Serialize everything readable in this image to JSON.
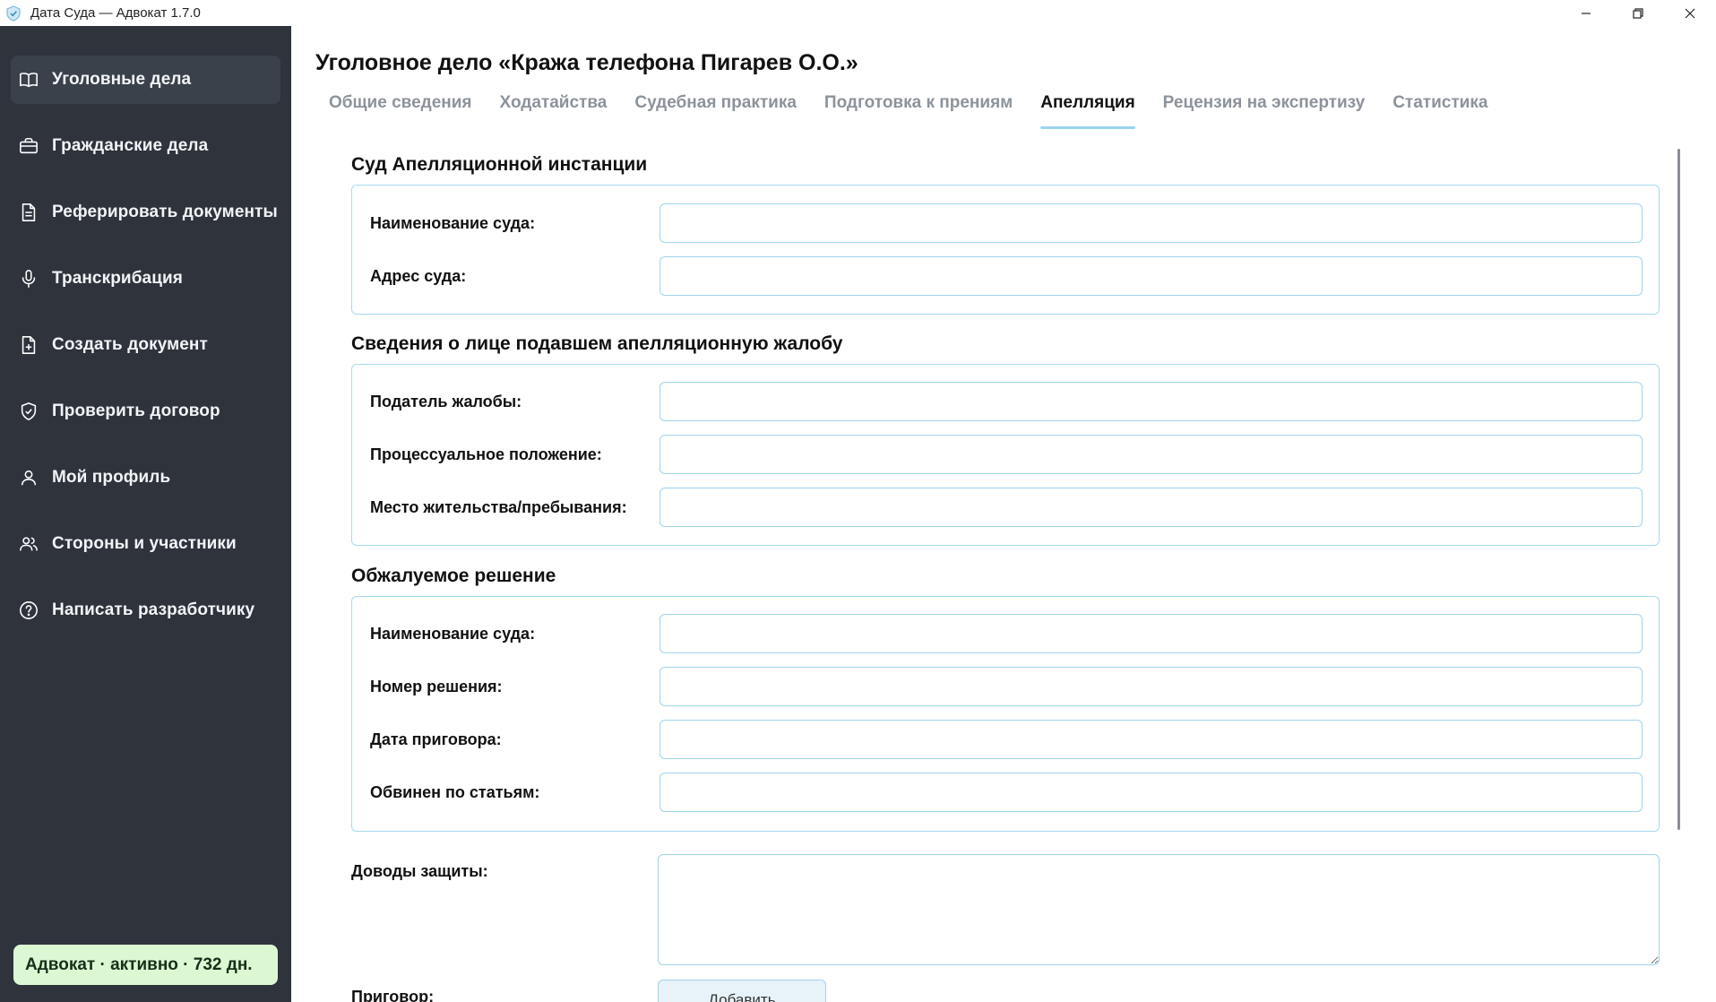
{
  "window": {
    "title": "Дата Суда — Адвокат 1.7.0"
  },
  "sidebar": {
    "items": [
      {
        "label": "Уголовные дела",
        "icon": "book-icon"
      },
      {
        "label": "Гражданские дела",
        "icon": "briefcase-icon"
      },
      {
        "label": "Реферировать документы",
        "icon": "document-text-icon"
      },
      {
        "label": "Транскрибация",
        "icon": "microphone-icon"
      },
      {
        "label": "Создать документ",
        "icon": "document-plus-icon"
      },
      {
        "label": "Проверить договор",
        "icon": "shield-check-icon"
      },
      {
        "label": "Мой профиль",
        "icon": "user-icon"
      },
      {
        "label": "Стороны и участники",
        "icon": "users-icon"
      },
      {
        "label": "Написать разработчику",
        "icon": "help-circle-icon"
      }
    ],
    "active_index": 0,
    "status": "Адвокат · активно · 732 дн."
  },
  "main": {
    "title": "Уголовное дело «Кража телефона Пигарев О.О.»",
    "tabs": [
      "Общие сведения",
      "Ходатайства",
      "Судебная практика",
      "Подготовка к прениям",
      "Апелляция",
      "Рецензия на экспертизу",
      "Статистика"
    ],
    "active_tab": 4,
    "sections": [
      {
        "title": "Суд Апелляционной инстанции",
        "fields": [
          {
            "label": "Наименование суда:",
            "value": ""
          },
          {
            "label": "Адрес суда:",
            "value": ""
          }
        ]
      },
      {
        "title": "Сведения о лице подавшем апелляционную жалобу",
        "fields": [
          {
            "label": "Податель жалобы:",
            "value": ""
          },
          {
            "label": "Процессуальное положение:",
            "value": ""
          },
          {
            "label": "Место жительства/пребывания:",
            "value": ""
          }
        ]
      },
      {
        "title": "Обжалуемое решение",
        "fields": [
          {
            "label": "Наименование суда:",
            "value": ""
          },
          {
            "label": "Номер решения:",
            "value": ""
          },
          {
            "label": "Дата приговора:",
            "value": ""
          },
          {
            "label": "Обвинен по статьям:",
            "value": ""
          }
        ]
      }
    ],
    "defense_args_label": "Доводы защиты:",
    "verdict_label": "Приговор:",
    "add_button": "Добавить"
  },
  "colors": {
    "sidebar_bg": "#2e333c",
    "sidebar_active": "#3b414b",
    "accent": "#9fd3ec",
    "status_bg": "#dcf8d3"
  }
}
